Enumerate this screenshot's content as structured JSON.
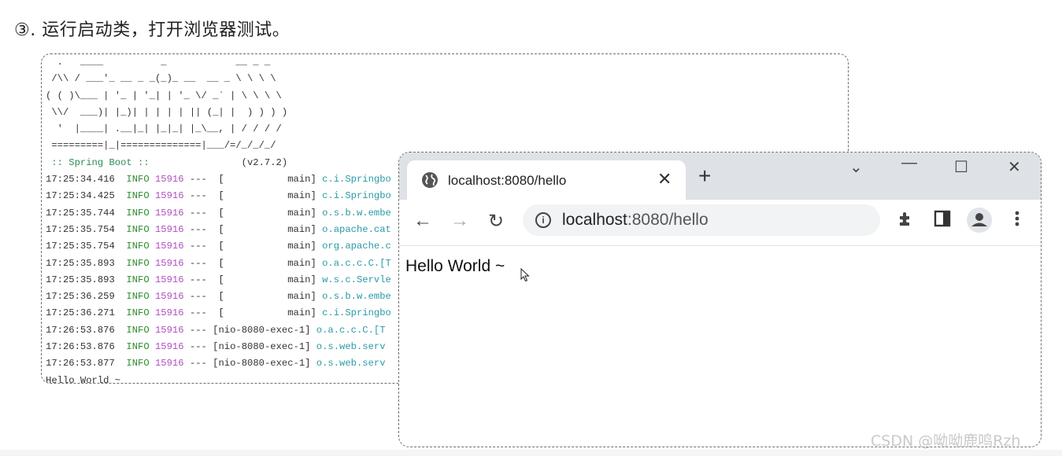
{
  "heading": "③. 运行启动类，打开浏览器测试。",
  "console": {
    "banner": [
      "  .   ____          _            __ _ _",
      " /\\\\ / ___'_ __ _ _(_)_ __  __ _ \\ \\ \\ \\",
      "( ( )\\___ | '_ | '_| | '_ \\/ _` | \\ \\ \\ \\",
      " \\\\/  ___)| |_)| | | | | || (_| |  ) ) ) )",
      "  '  |____| .__|_| |_|_| |_\\__, | / / / /",
      " =========|_|==============|___/=/_/_/_/"
    ],
    "spring_label": " :: Spring Boot ::",
    "version": "                (v2.7.2)",
    "logs": [
      {
        "time": "17:25:34.416",
        "level": "INFO",
        "pid": "15916",
        "thread": "---  [           main]",
        "cls": "c.i.Springbo"
      },
      {
        "time": "17:25:34.425",
        "level": "INFO",
        "pid": "15916",
        "thread": "---  [           main]",
        "cls": "c.i.Springbo"
      },
      {
        "time": "17:25:35.744",
        "level": "INFO",
        "pid": "15916",
        "thread": "---  [           main]",
        "cls": "o.s.b.w.embe"
      },
      {
        "time": "17:25:35.754",
        "level": "INFO",
        "pid": "15916",
        "thread": "---  [           main]",
        "cls": "o.apache.cat"
      },
      {
        "time": "17:25:35.754",
        "level": "INFO",
        "pid": "15916",
        "thread": "---  [           main]",
        "cls": "org.apache.c"
      },
      {
        "time": "17:25:35.893",
        "level": "INFO",
        "pid": "15916",
        "thread": "---  [           main]",
        "cls": "o.a.c.c.C.[T"
      },
      {
        "time": "17:25:35.893",
        "level": "INFO",
        "pid": "15916",
        "thread": "---  [           main]",
        "cls": "w.s.c.Servle"
      },
      {
        "time": "17:25:36.259",
        "level": "INFO",
        "pid": "15916",
        "thread": "---  [           main]",
        "cls": "o.s.b.w.embe"
      },
      {
        "time": "17:25:36.271",
        "level": "INFO",
        "pid": "15916",
        "thread": "---  [           main]",
        "cls": "c.i.Springbo"
      },
      {
        "time": "17:26:53.876",
        "level": "INFO",
        "pid": "15916",
        "thread": "--- [nio-8080-exec-1]",
        "cls": "o.a.c.c.C.[T"
      },
      {
        "time": "17:26:53.876",
        "level": "INFO",
        "pid": "15916",
        "thread": "--- [nio-8080-exec-1]",
        "cls": "o.s.web.serv"
      },
      {
        "time": "17:26:53.877",
        "level": "INFO",
        "pid": "15916",
        "thread": "--- [nio-8080-exec-1]",
        "cls": "o.s.web.serv"
      }
    ],
    "final_line": "Hello World ~"
  },
  "browser": {
    "tab_title": "localhost:8080/hello",
    "tab_close": "✕",
    "new_tab": "+",
    "window": {
      "dropdown": "⌄",
      "minimize": "—",
      "maximize": "☐",
      "close": "✕"
    },
    "nav": {
      "back": "←",
      "forward": "→",
      "reload": "↻"
    },
    "url_host": "localhost",
    "url_rest": ":8080/hello",
    "info_icon": "i",
    "page_text": "Hello World ~"
  },
  "watermark": "CSDN @呦呦鹿鸣Rzh",
  "colors": {
    "info": "#2e8b2e",
    "pid": "#b050c0",
    "logger": "#2a9aa8",
    "tabbar": "#dee1e6"
  }
}
